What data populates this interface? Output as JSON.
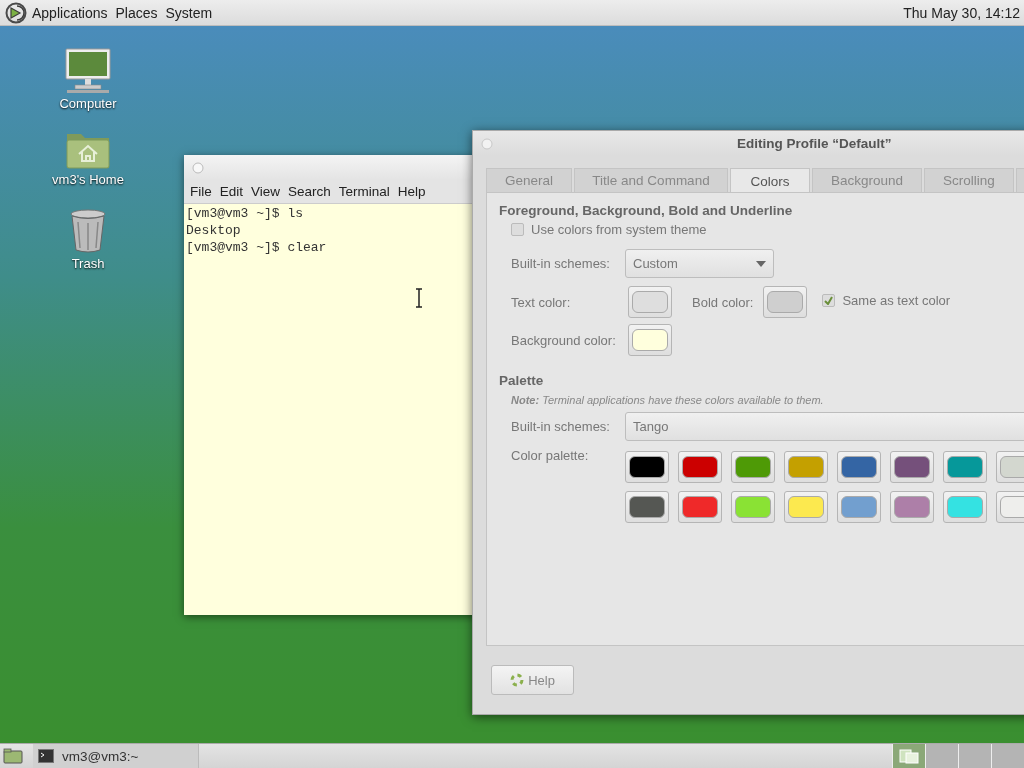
{
  "top_panel": {
    "menus": [
      "Applications",
      "Places",
      "System"
    ],
    "clock": "Thu May 30, 14:12"
  },
  "desktop_icons": [
    {
      "kind": "computer",
      "label": "Computer"
    },
    {
      "kind": "home",
      "label": "vm3's Home"
    },
    {
      "kind": "trash",
      "label": "Trash"
    }
  ],
  "terminal": {
    "menu": [
      "File",
      "Edit",
      "View",
      "Search",
      "Terminal",
      "Help"
    ],
    "lines": [
      "[vm3@vm3 ~]$ ls",
      "Desktop",
      "[vm3@vm3 ~]$ clear"
    ]
  },
  "dialog": {
    "title": "Editing Profile “Default”",
    "tabs": [
      {
        "label": "General",
        "selected": false
      },
      {
        "label": "Title and Command",
        "selected": false
      },
      {
        "label": "Colors",
        "selected": true
      },
      {
        "label": "Background",
        "selected": false
      },
      {
        "label": "Scrolling",
        "selected": false
      }
    ],
    "fg_section": {
      "heading": "Foreground, Background, Bold and Underline",
      "system_theme": {
        "label": "Use colors from system theme",
        "checked": false
      },
      "schemes": {
        "label": "Built-in schemes:",
        "value": "Custom"
      },
      "text_color": {
        "label": "Text color:",
        "color": "#dedede"
      },
      "bold_color": {
        "label": "Bold color:",
        "color": "#cfcfcf"
      },
      "same_as_text": {
        "label": "Same as text color",
        "checked": true
      },
      "background_color": {
        "label": "Background color:",
        "color": "#ffffdd"
      }
    },
    "palette": {
      "heading": "Palette",
      "note": "**Note:** Terminal applications have these colors available to them.",
      "schemes": {
        "label": "Built-in schemes:",
        "value": "Tango"
      },
      "label": "Color palette:",
      "swatches": [
        {
          "color": "#000000"
        },
        {
          "color": "#cc0000"
        },
        {
          "color": "#4e9a06"
        },
        {
          "color": "#c4a000"
        },
        {
          "color": "#3465a4"
        },
        {
          "color": "#75507b"
        },
        {
          "color": "#06989a"
        },
        {
          "color": "#d3d7cf"
        },
        {
          "color": "#555753"
        },
        {
          "color": "#ef2929"
        },
        {
          "color": "#8ae234"
        },
        {
          "color": "#fce94f"
        },
        {
          "color": "#729fcf"
        },
        {
          "color": "#ad7fa8"
        },
        {
          "color": "#34e2e2"
        },
        {
          "color": "#eeeeec"
        }
      ]
    },
    "help_button": "Help"
  },
  "bottom_panel": {
    "tasks": [
      {
        "label": "vm3@vm3:~",
        "selected": false
      }
    ],
    "workspaces": [
      {
        "selected": true
      },
      {
        "selected": false
      },
      {
        "selected": false
      },
      {
        "selected": false
      }
    ]
  }
}
